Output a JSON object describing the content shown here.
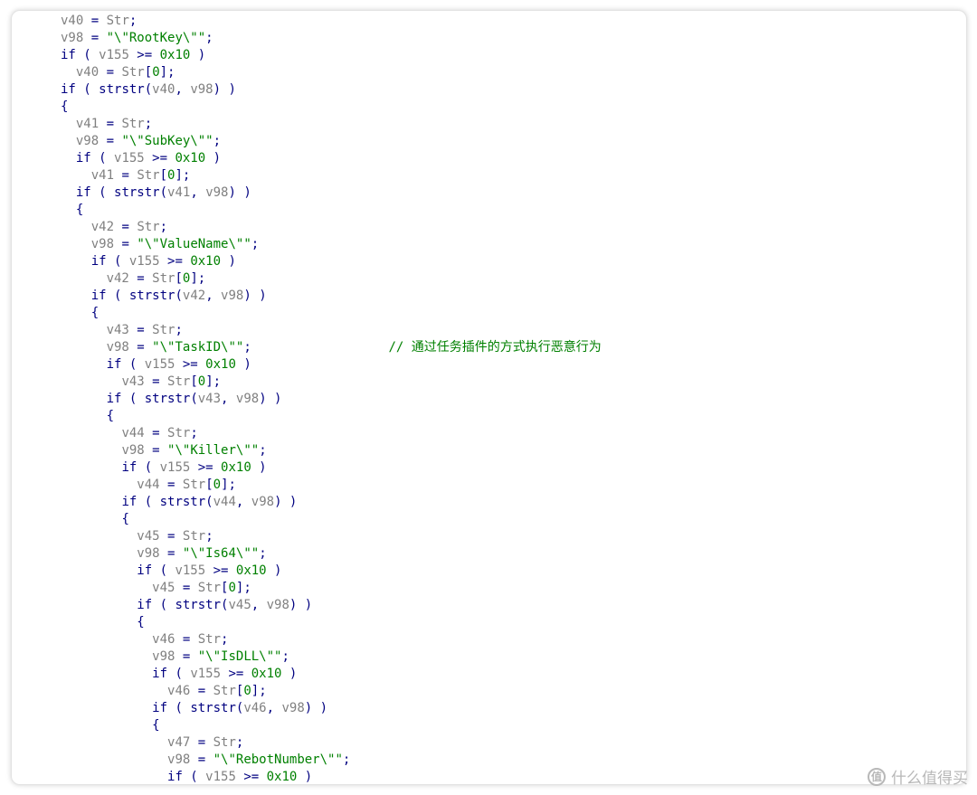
{
  "code_lines": [
    {
      "indent": 0,
      "tokens": [
        [
          "var",
          "v40"
        ],
        [
          "op",
          " = "
        ],
        [
          "var",
          "Str"
        ],
        [
          "op",
          ";"
        ]
      ]
    },
    {
      "indent": 0,
      "tokens": [
        [
          "var",
          "v98"
        ],
        [
          "op",
          " = "
        ],
        [
          "str",
          "\"\\\"RootKey\\\"\""
        ],
        [
          "op",
          ";"
        ]
      ]
    },
    {
      "indent": 0,
      "tokens": [
        [
          "kw",
          "if"
        ],
        [
          "op",
          " ( "
        ],
        [
          "var",
          "v155"
        ],
        [
          "op",
          " >= "
        ],
        [
          "num",
          "0x10"
        ],
        [
          "op",
          " )"
        ]
      ]
    },
    {
      "indent": 1,
      "tokens": [
        [
          "var",
          "v40"
        ],
        [
          "op",
          " = "
        ],
        [
          "var",
          "Str"
        ],
        [
          "op",
          "["
        ],
        [
          "num",
          "0"
        ],
        [
          "op",
          "];"
        ]
      ]
    },
    {
      "indent": 0,
      "tokens": [
        [
          "kw",
          "if"
        ],
        [
          "op",
          " ( "
        ],
        [
          "kw",
          "strstr"
        ],
        [
          "op",
          "("
        ],
        [
          "var",
          "v40"
        ],
        [
          "op",
          ", "
        ],
        [
          "var",
          "v98"
        ],
        [
          "op",
          ") )"
        ]
      ]
    },
    {
      "indent": 0,
      "tokens": [
        [
          "op",
          "{"
        ]
      ]
    },
    {
      "indent": 1,
      "tokens": [
        [
          "var",
          "v41"
        ],
        [
          "op",
          " = "
        ],
        [
          "var",
          "Str"
        ],
        [
          "op",
          ";"
        ]
      ]
    },
    {
      "indent": 1,
      "tokens": [
        [
          "var",
          "v98"
        ],
        [
          "op",
          " = "
        ],
        [
          "str",
          "\"\\\"SubKey\\\"\""
        ],
        [
          "op",
          ";"
        ]
      ]
    },
    {
      "indent": 1,
      "tokens": [
        [
          "kw",
          "if"
        ],
        [
          "op",
          " ( "
        ],
        [
          "var",
          "v155"
        ],
        [
          "op",
          " >= "
        ],
        [
          "num",
          "0x10"
        ],
        [
          "op",
          " )"
        ]
      ]
    },
    {
      "indent": 2,
      "tokens": [
        [
          "var",
          "v41"
        ],
        [
          "op",
          " = "
        ],
        [
          "var",
          "Str"
        ],
        [
          "op",
          "["
        ],
        [
          "num",
          "0"
        ],
        [
          "op",
          "];"
        ]
      ]
    },
    {
      "indent": 1,
      "tokens": [
        [
          "kw",
          "if"
        ],
        [
          "op",
          " ( "
        ],
        [
          "kw",
          "strstr"
        ],
        [
          "op",
          "("
        ],
        [
          "var",
          "v41"
        ],
        [
          "op",
          ", "
        ],
        [
          "var",
          "v98"
        ],
        [
          "op",
          ") )"
        ]
      ]
    },
    {
      "indent": 1,
      "tokens": [
        [
          "op",
          "{"
        ]
      ]
    },
    {
      "indent": 2,
      "tokens": [
        [
          "var",
          "v42"
        ],
        [
          "op",
          " = "
        ],
        [
          "var",
          "Str"
        ],
        [
          "op",
          ";"
        ]
      ]
    },
    {
      "indent": 2,
      "tokens": [
        [
          "var",
          "v98"
        ],
        [
          "op",
          " = "
        ],
        [
          "str",
          "\"\\\"ValueName\\\"\""
        ],
        [
          "op",
          ";"
        ]
      ]
    },
    {
      "indent": 2,
      "tokens": [
        [
          "kw",
          "if"
        ],
        [
          "op",
          " ( "
        ],
        [
          "var",
          "v155"
        ],
        [
          "op",
          " >= "
        ],
        [
          "num",
          "0x10"
        ],
        [
          "op",
          " )"
        ]
      ]
    },
    {
      "indent": 3,
      "tokens": [
        [
          "var",
          "v42"
        ],
        [
          "op",
          " = "
        ],
        [
          "var",
          "Str"
        ],
        [
          "op",
          "["
        ],
        [
          "num",
          "0"
        ],
        [
          "op",
          "];"
        ]
      ]
    },
    {
      "indent": 2,
      "tokens": [
        [
          "kw",
          "if"
        ],
        [
          "op",
          " ( "
        ],
        [
          "kw",
          "strstr"
        ],
        [
          "op",
          "("
        ],
        [
          "var",
          "v42"
        ],
        [
          "op",
          ", "
        ],
        [
          "var",
          "v98"
        ],
        [
          "op",
          ") )"
        ]
      ]
    },
    {
      "indent": 2,
      "tokens": [
        [
          "op",
          "{"
        ]
      ]
    },
    {
      "indent": 3,
      "tokens": [
        [
          "var",
          "v43"
        ],
        [
          "op",
          " = "
        ],
        [
          "var",
          "Str"
        ],
        [
          "op",
          ";"
        ]
      ]
    },
    {
      "indent": 3,
      "tokens": [
        [
          "var",
          "v98"
        ],
        [
          "op",
          " = "
        ],
        [
          "str",
          "\"\\\"TaskID\\\"\""
        ],
        [
          "op",
          ";"
        ],
        [
          "pad",
          "                  "
        ],
        [
          "cmt",
          "// "
        ],
        [
          "cmttext",
          "通过任务插件的方式执行恶意行为"
        ]
      ]
    },
    {
      "indent": 3,
      "tokens": [
        [
          "kw",
          "if"
        ],
        [
          "op",
          " ( "
        ],
        [
          "var",
          "v155"
        ],
        [
          "op",
          " >= "
        ],
        [
          "num",
          "0x10"
        ],
        [
          "op",
          " )"
        ]
      ]
    },
    {
      "indent": 4,
      "tokens": [
        [
          "var",
          "v43"
        ],
        [
          "op",
          " = "
        ],
        [
          "var",
          "Str"
        ],
        [
          "op",
          "["
        ],
        [
          "num",
          "0"
        ],
        [
          "op",
          "];"
        ]
      ]
    },
    {
      "indent": 3,
      "tokens": [
        [
          "kw",
          "if"
        ],
        [
          "op",
          " ( "
        ],
        [
          "kw",
          "strstr"
        ],
        [
          "op",
          "("
        ],
        [
          "var",
          "v43"
        ],
        [
          "op",
          ", "
        ],
        [
          "var",
          "v98"
        ],
        [
          "op",
          ") )"
        ]
      ]
    },
    {
      "indent": 3,
      "tokens": [
        [
          "op",
          "{"
        ]
      ]
    },
    {
      "indent": 4,
      "tokens": [
        [
          "var",
          "v44"
        ],
        [
          "op",
          " = "
        ],
        [
          "var",
          "Str"
        ],
        [
          "op",
          ";"
        ]
      ]
    },
    {
      "indent": 4,
      "tokens": [
        [
          "var",
          "v98"
        ],
        [
          "op",
          " = "
        ],
        [
          "str",
          "\"\\\"Killer\\\"\""
        ],
        [
          "op",
          ";"
        ]
      ]
    },
    {
      "indent": 4,
      "tokens": [
        [
          "kw",
          "if"
        ],
        [
          "op",
          " ( "
        ],
        [
          "var",
          "v155"
        ],
        [
          "op",
          " >= "
        ],
        [
          "num",
          "0x10"
        ],
        [
          "op",
          " )"
        ]
      ]
    },
    {
      "indent": 5,
      "tokens": [
        [
          "var",
          "v44"
        ],
        [
          "op",
          " = "
        ],
        [
          "var",
          "Str"
        ],
        [
          "op",
          "["
        ],
        [
          "num",
          "0"
        ],
        [
          "op",
          "];"
        ]
      ]
    },
    {
      "indent": 4,
      "tokens": [
        [
          "kw",
          "if"
        ],
        [
          "op",
          " ( "
        ],
        [
          "kw",
          "strstr"
        ],
        [
          "op",
          "("
        ],
        [
          "var",
          "v44"
        ],
        [
          "op",
          ", "
        ],
        [
          "var",
          "v98"
        ],
        [
          "op",
          ") )"
        ]
      ]
    },
    {
      "indent": 4,
      "tokens": [
        [
          "op",
          "{"
        ]
      ]
    },
    {
      "indent": 5,
      "tokens": [
        [
          "var",
          "v45"
        ],
        [
          "op",
          " = "
        ],
        [
          "var",
          "Str"
        ],
        [
          "op",
          ";"
        ]
      ]
    },
    {
      "indent": 5,
      "tokens": [
        [
          "var",
          "v98"
        ],
        [
          "op",
          " = "
        ],
        [
          "str",
          "\"\\\"Is64\\\"\""
        ],
        [
          "op",
          ";"
        ]
      ]
    },
    {
      "indent": 5,
      "tokens": [
        [
          "kw",
          "if"
        ],
        [
          "op",
          " ( "
        ],
        [
          "var",
          "v155"
        ],
        [
          "op",
          " >= "
        ],
        [
          "num",
          "0x10"
        ],
        [
          "op",
          " )"
        ]
      ]
    },
    {
      "indent": 6,
      "tokens": [
        [
          "var",
          "v45"
        ],
        [
          "op",
          " = "
        ],
        [
          "var",
          "Str"
        ],
        [
          "op",
          "["
        ],
        [
          "num",
          "0"
        ],
        [
          "op",
          "];"
        ]
      ]
    },
    {
      "indent": 5,
      "tokens": [
        [
          "kw",
          "if"
        ],
        [
          "op",
          " ( "
        ],
        [
          "kw",
          "strstr"
        ],
        [
          "op",
          "("
        ],
        [
          "var",
          "v45"
        ],
        [
          "op",
          ", "
        ],
        [
          "var",
          "v98"
        ],
        [
          "op",
          ") )"
        ]
      ]
    },
    {
      "indent": 5,
      "tokens": [
        [
          "op",
          "{"
        ]
      ]
    },
    {
      "indent": 6,
      "tokens": [
        [
          "var",
          "v46"
        ],
        [
          "op",
          " = "
        ],
        [
          "var",
          "Str"
        ],
        [
          "op",
          ";"
        ]
      ]
    },
    {
      "indent": 6,
      "tokens": [
        [
          "var",
          "v98"
        ],
        [
          "op",
          " = "
        ],
        [
          "str",
          "\"\\\"IsDLL\\\"\""
        ],
        [
          "op",
          ";"
        ]
      ]
    },
    {
      "indent": 6,
      "tokens": [
        [
          "kw",
          "if"
        ],
        [
          "op",
          " ( "
        ],
        [
          "var",
          "v155"
        ],
        [
          "op",
          " >= "
        ],
        [
          "num",
          "0x10"
        ],
        [
          "op",
          " )"
        ]
      ]
    },
    {
      "indent": 7,
      "tokens": [
        [
          "var",
          "v46"
        ],
        [
          "op",
          " = "
        ],
        [
          "var",
          "Str"
        ],
        [
          "op",
          "["
        ],
        [
          "num",
          "0"
        ],
        [
          "op",
          "];"
        ]
      ]
    },
    {
      "indent": 6,
      "tokens": [
        [
          "kw",
          "if"
        ],
        [
          "op",
          " ( "
        ],
        [
          "kw",
          "strstr"
        ],
        [
          "op",
          "("
        ],
        [
          "var",
          "v46"
        ],
        [
          "op",
          ", "
        ],
        [
          "var",
          "v98"
        ],
        [
          "op",
          ") )"
        ]
      ]
    },
    {
      "indent": 6,
      "tokens": [
        [
          "op",
          "{"
        ]
      ]
    },
    {
      "indent": 7,
      "tokens": [
        [
          "var",
          "v47"
        ],
        [
          "op",
          " = "
        ],
        [
          "var",
          "Str"
        ],
        [
          "op",
          ";"
        ]
      ]
    },
    {
      "indent": 7,
      "tokens": [
        [
          "var",
          "v98"
        ],
        [
          "op",
          " = "
        ],
        [
          "str",
          "\"\\\"RebotNumber\\\"\""
        ],
        [
          "op",
          ";"
        ]
      ]
    },
    {
      "indent": 7,
      "tokens": [
        [
          "kw",
          "if"
        ],
        [
          "op",
          " ( "
        ],
        [
          "var",
          "v155"
        ],
        [
          "op",
          " >= "
        ],
        [
          "num",
          "0x10"
        ],
        [
          "op",
          " )"
        ]
      ]
    }
  ],
  "watermark": {
    "icon_glyph": "值",
    "text": "什么值得买"
  },
  "colors": {
    "keyword": "#000080",
    "variable": "#808080",
    "string": "#008000",
    "comment": "#008000",
    "watermark": "#b8b8b8"
  }
}
